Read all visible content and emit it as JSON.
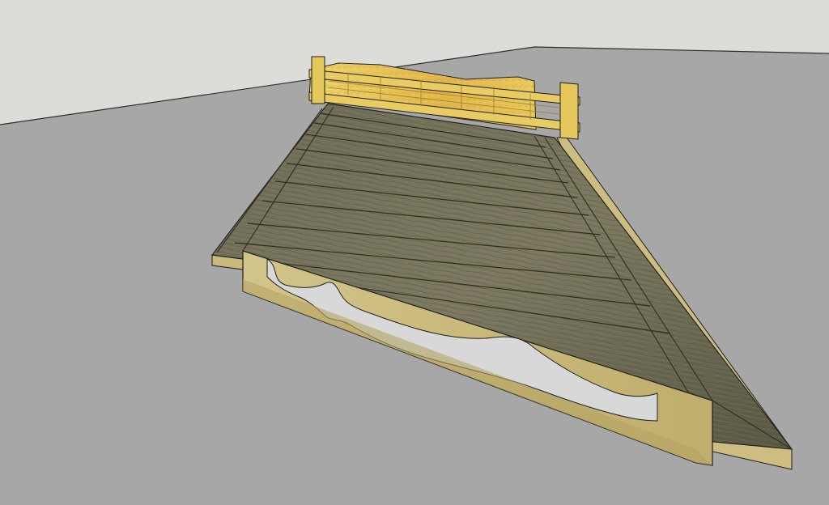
{
  "scene": {
    "description_free": true,
    "colors": {
      "sky": "#dcdcd9",
      "ground": "#a7a7a7",
      "horizon_line": "#2e2e2e",
      "wood_top_light": "#85826a",
      "wood_top_dark": "#5f5c48",
      "wood_grain": "#4a4736",
      "plank_seam": "#2f2d22",
      "side_panel": "#c9b97c",
      "side_panel_shadow": "#b4a364",
      "rail_yellow": "#e2c75a",
      "rail_orange": "#e0a93c",
      "outline": "#1f1f1f",
      "gap_floor": "#d9d9d9"
    }
  }
}
